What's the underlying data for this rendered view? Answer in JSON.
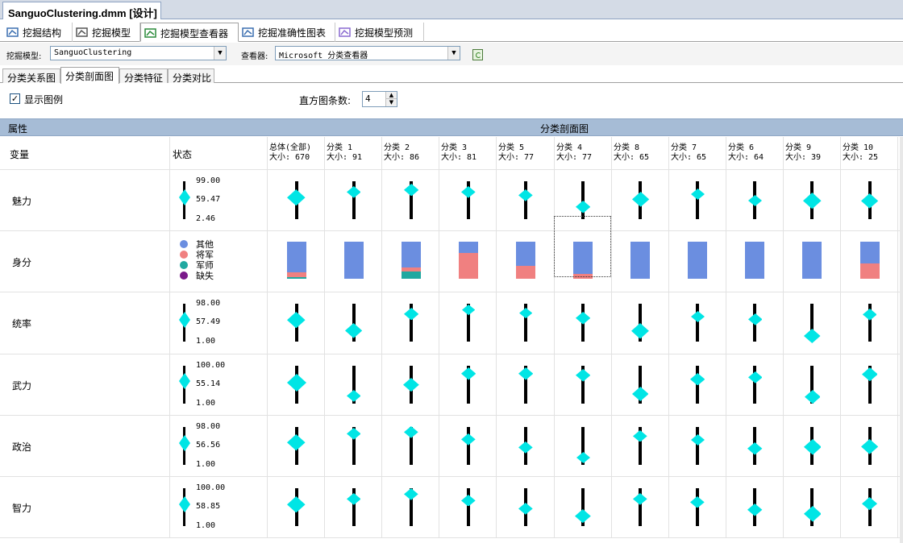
{
  "document_tab": "SanguoClustering.dmm [设计]",
  "designer_tabs": [
    {
      "label": "挖掘结构",
      "icon": "structure-icon"
    },
    {
      "label": "挖掘模型",
      "icon": "model-icon"
    },
    {
      "label": "挖掘模型查看器",
      "icon": "viewer-icon"
    },
    {
      "label": "挖掘准确性图表",
      "icon": "accuracy-chart-icon"
    },
    {
      "label": "挖掘模型预测",
      "icon": "prediction-icon"
    }
  ],
  "active_designer_tab": 2,
  "toolbar": {
    "model_label": "挖掘模型:",
    "model_value": "SanguoClustering",
    "viewer_label": "查看器:",
    "viewer_value": "Microsoft 分类查看器"
  },
  "sub_tabs": [
    "分类关系图",
    "分类剖面图",
    "分类特征",
    "分类对比"
  ],
  "active_sub_tab": 1,
  "options": {
    "show_legend_label": "显示图例",
    "show_legend_checked": true,
    "check_mark": "✓",
    "histogram_label": "直方图条数:",
    "histogram_value": "4"
  },
  "grid_header": {
    "attributes": "属性",
    "profiles": "分类剖面图",
    "variable": "变量",
    "state": "状态"
  },
  "columns": [
    {
      "name": "总体(全部)",
      "size": "大小: 670"
    },
    {
      "name": "分类 1",
      "size": "大小: 91"
    },
    {
      "name": "分类 2",
      "size": "大小: 86"
    },
    {
      "name": "分类 3",
      "size": "大小: 81"
    },
    {
      "name": "分类 5",
      "size": "大小: 77"
    },
    {
      "name": "分类 4",
      "size": "大小: 77"
    },
    {
      "name": "分类 8",
      "size": "大小: 65"
    },
    {
      "name": "分类 7",
      "size": "大小: 65"
    },
    {
      "name": "分类 6",
      "size": "大小: 64"
    },
    {
      "name": "分类 9",
      "size": "大小: 39"
    },
    {
      "name": "分类 10",
      "size": "大小: 25"
    }
  ],
  "rows": [
    {
      "name": "魅力",
      "type": "continuous",
      "max": "99.00",
      "mean": "59.47",
      "min": "2.46",
      "markers": [
        {
          "pos": 0.42,
          "size": 0.9
        },
        {
          "pos": 0.28,
          "size": 0.55
        },
        {
          "pos": 0.22,
          "size": 0.6
        },
        {
          "pos": 0.28,
          "size": 0.55
        },
        {
          "pos": 0.38,
          "size": 0.55
        },
        {
          "pos": 0.68,
          "size": 0.6
        },
        {
          "pos": 0.48,
          "size": 0.8
        },
        {
          "pos": 0.34,
          "size": 0.5
        },
        {
          "pos": 0.52,
          "size": 0.5
        },
        {
          "pos": 0.52,
          "size": 0.9
        },
        {
          "pos": 0.52,
          "size": 0.8
        }
      ]
    },
    {
      "name": "身分",
      "type": "discrete",
      "legend": [
        {
          "label": "其他",
          "color": "#6b8ee0"
        },
        {
          "label": "将军",
          "color": "#f08080"
        },
        {
          "label": "军师",
          "color": "#20a8a0"
        },
        {
          "label": "缺失",
          "color": "#7a1a8a"
        }
      ],
      "stacks": [
        [
          0.82,
          0.14,
          0.04,
          0.0
        ],
        [
          1.0,
          0.0,
          0.0,
          0.0
        ],
        [
          0.7,
          0.1,
          0.2,
          0.0
        ],
        [
          0.3,
          0.7,
          0.0,
          0.0
        ],
        [
          0.64,
          0.36,
          0.0,
          0.0
        ],
        [
          0.86,
          0.14,
          0.0,
          0.0
        ],
        [
          1.0,
          0.0,
          0.0,
          0.0
        ],
        [
          1.0,
          0.0,
          0.0,
          0.0
        ],
        [
          1.0,
          0.0,
          0.0,
          0.0
        ],
        [
          1.0,
          0.0,
          0.0,
          0.0
        ],
        [
          0.58,
          0.42,
          0.0,
          0.0
        ]
      ]
    },
    {
      "name": "统率",
      "type": "continuous",
      "max": "98.00",
      "mean": "57.49",
      "min": "1.00",
      "markers": [
        {
          "pos": 0.42,
          "size": 0.9
        },
        {
          "pos": 0.7,
          "size": 0.8
        },
        {
          "pos": 0.26,
          "size": 0.6
        },
        {
          "pos": 0.16,
          "size": 0.45
        },
        {
          "pos": 0.24,
          "size": 0.45
        },
        {
          "pos": 0.38,
          "size": 0.6
        },
        {
          "pos": 0.72,
          "size": 0.85
        },
        {
          "pos": 0.34,
          "size": 0.5
        },
        {
          "pos": 0.4,
          "size": 0.55
        },
        {
          "pos": 0.84,
          "size": 0.75
        },
        {
          "pos": 0.28,
          "size": 0.55
        }
      ]
    },
    {
      "name": "武力",
      "type": "continuous",
      "max": "100.00",
      "mean": "55.14",
      "min": "1.00",
      "markers": [
        {
          "pos": 0.46,
          "size": 1.0
        },
        {
          "pos": 0.8,
          "size": 0.55
        },
        {
          "pos": 0.5,
          "size": 0.7
        },
        {
          "pos": 0.22,
          "size": 0.6
        },
        {
          "pos": 0.22,
          "size": 0.6
        },
        {
          "pos": 0.26,
          "size": 0.6
        },
        {
          "pos": 0.76,
          "size": 0.75
        },
        {
          "pos": 0.36,
          "size": 0.6
        },
        {
          "pos": 0.32,
          "size": 0.55
        },
        {
          "pos": 0.82,
          "size": 0.7
        },
        {
          "pos": 0.24,
          "size": 0.7
        }
      ]
    },
    {
      "name": "政治",
      "type": "continuous",
      "max": "98.00",
      "mean": "56.56",
      "min": "1.00",
      "markers": [
        {
          "pos": 0.42,
          "size": 0.9
        },
        {
          "pos": 0.18,
          "size": 0.55
        },
        {
          "pos": 0.14,
          "size": 0.55
        },
        {
          "pos": 0.34,
          "size": 0.55
        },
        {
          "pos": 0.54,
          "size": 0.55
        },
        {
          "pos": 0.82,
          "size": 0.5
        },
        {
          "pos": 0.24,
          "size": 0.55
        },
        {
          "pos": 0.34,
          "size": 0.5
        },
        {
          "pos": 0.58,
          "size": 0.6
        },
        {
          "pos": 0.54,
          "size": 0.85
        },
        {
          "pos": 0.52,
          "size": 0.8
        }
      ]
    },
    {
      "name": "智力",
      "type": "continuous",
      "max": "100.00",
      "mean": "58.85",
      "min": "1.00",
      "markers": [
        {
          "pos": 0.42,
          "size": 0.9
        },
        {
          "pos": 0.28,
          "size": 0.55
        },
        {
          "pos": 0.16,
          "size": 0.55
        },
        {
          "pos": 0.32,
          "size": 0.55
        },
        {
          "pos": 0.54,
          "size": 0.55
        },
        {
          "pos": 0.74,
          "size": 0.7
        },
        {
          "pos": 0.28,
          "size": 0.55
        },
        {
          "pos": 0.36,
          "size": 0.55
        },
        {
          "pos": 0.58,
          "size": 0.6
        },
        {
          "pos": 0.68,
          "size": 0.85
        },
        {
          "pos": 0.4,
          "size": 0.65
        }
      ]
    }
  ],
  "colors": {
    "marker": "#00e5e5",
    "bar": "#000000",
    "header_band": "#a6bcd6",
    "grid_line": "#e2e2e2"
  }
}
